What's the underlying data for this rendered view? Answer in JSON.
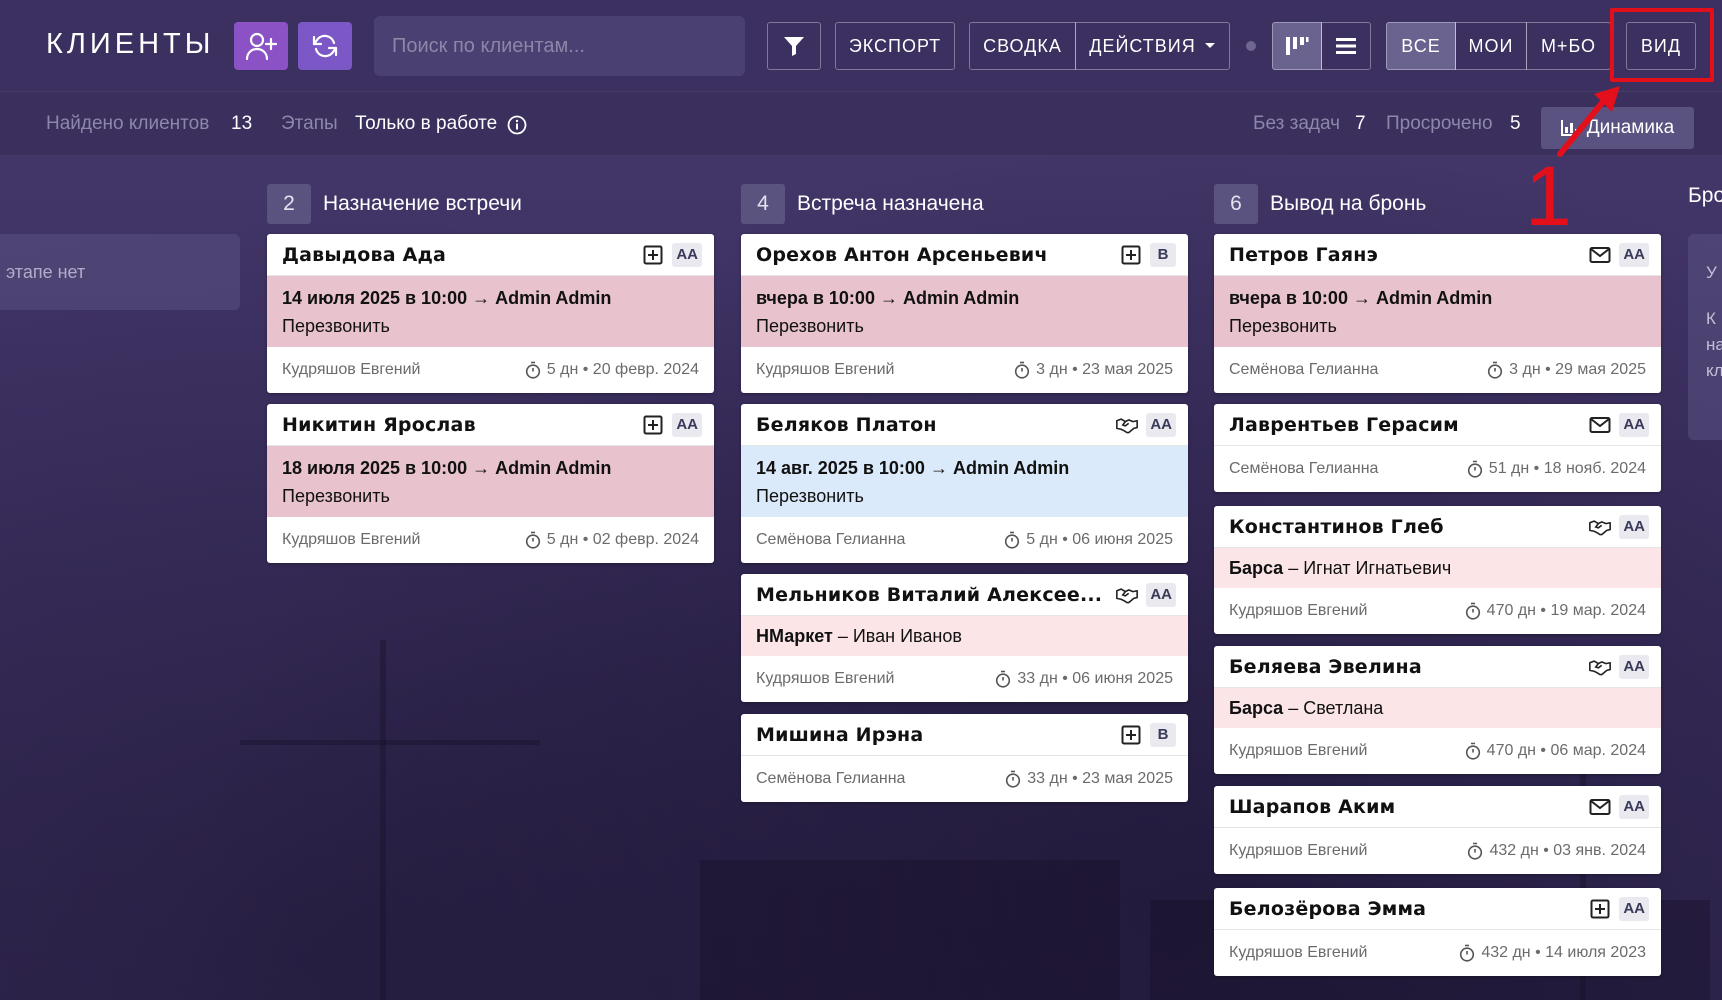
{
  "header": {
    "title": "КЛИЕНТЫ",
    "search_placeholder": "Поиск по клиентам...",
    "export_label": "ЭКСПОРТ",
    "summary_label": "СВОДКА",
    "actions_label": "ДЕЙСТВИЯ",
    "filter_all": "ВСЕ",
    "filter_mine": "МОИ",
    "filter_mplus": "М+БО",
    "view_label": "ВИД"
  },
  "subbar": {
    "found_label": "Найдено клиентов",
    "found_count": "13",
    "stages_label": "Этапы",
    "stages_value": "Только в работе",
    "no_tasks_label": "Без задач",
    "no_tasks_count": "7",
    "overdue_label": "Просрочено",
    "overdue_count": "5",
    "dynamics_label": "Динамика"
  },
  "annotation": {
    "step_number": "1"
  },
  "columns": {
    "left_empty_text": "этапе нет",
    "partial_next": {
      "title": "Бро",
      "lines": [
        "У",
        "К",
        "на",
        "кл"
      ]
    },
    "col1": {
      "count": "2",
      "title": "Назначение встречи",
      "cards": [
        {
          "name": "Давыдова Ада",
          "icon": "plus-square-icon",
          "badge": "АА",
          "task_line": "14 июля 2025 в 10:00 → Admin Admin",
          "task_note": "Перезвонить",
          "manager": "Кудряшов Евгений",
          "meta": "5 дн • 20 февр. 2024"
        },
        {
          "name": "Никитин Ярослав",
          "icon": "plus-square-icon",
          "badge": "АА",
          "task_line": "18 июля 2025 в 10:00 → Admin Admin",
          "task_note": "Перезвонить",
          "manager": "Кудряшов Евгений",
          "meta": "5 дн • 02 февр. 2024"
        }
      ]
    },
    "col2": {
      "count": "4",
      "title": "Встреча назначена",
      "cards": [
        {
          "name": "Орехов Антон Арсеньевич",
          "icon": "plus-square-icon",
          "badge": "В",
          "task_line": "вчера в 10:00 → Admin Admin",
          "task_note": "Перезвонить",
          "manager": "Кудряшов Евгений",
          "meta": "3 дн • 23 мая 2025"
        },
        {
          "name": "Беляков Платон",
          "icon": "handshake-icon",
          "badge": "АА",
          "task_line": "14 авг. 2025 в 10:00 → Admin Admin",
          "task_note": "Перезвонить",
          "manager": "Семёнова Гелианна",
          "meta": "5 дн • 06 июня 2025"
        },
        {
          "name": "Мельников Виталий Алексее...",
          "icon": "handshake-icon",
          "badge": "АА",
          "partner_bold": "НМаркет",
          "partner_rest": " – Иван Иванов",
          "manager": "Кудряшов Евгений",
          "meta": "33 дн • 06 июня 2025"
        },
        {
          "name": "Мишина Ирэна",
          "icon": "plus-square-icon",
          "badge": "В",
          "manager": "Семёнова Гелианна",
          "meta": "33 дн • 23 мая 2025"
        }
      ]
    },
    "col3": {
      "count": "6",
      "title": "Вывод на бронь",
      "cards": [
        {
          "name": "Петров Гаянэ",
          "icon": "mail-icon",
          "badge": "АА",
          "task_line": "вчера в 10:00 → Admin Admin",
          "task_note": "Перезвонить",
          "manager": "Семёнова Гелианна",
          "meta": "3 дн • 29 мая 2025"
        },
        {
          "name": "Лаврентьев Герасим",
          "icon": "mail-icon",
          "badge": "АА",
          "manager": "Семёнова Гелианна",
          "meta": "51 дн • 18 нояб. 2024"
        },
        {
          "name": "Константинов Глеб",
          "icon": "handshake-icon",
          "badge": "АА",
          "partner_bold": "Барса",
          "partner_rest": " – Игнат Игнатьевич",
          "manager": "Кудряшов Евгений",
          "meta": "470 дн • 19 мар. 2024"
        },
        {
          "name": "Беляева Эвелина",
          "icon": "handshake-icon",
          "badge": "АА",
          "partner_bold": "Барса",
          "partner_rest": " – Светлана",
          "manager": "Кудряшов Евгений",
          "meta": "470 дн • 06 мар. 2024"
        },
        {
          "name": "Шарапов Аким",
          "icon": "mail-icon",
          "badge": "АА",
          "manager": "Кудряшов Евгений",
          "meta": "432 дн • 03 янв. 2024"
        },
        {
          "name": "Белозёрова Эмма",
          "icon": "plus-square-icon",
          "badge": "АА",
          "manager": "Кудряшов Евгений",
          "meta": "432 дн • 14 июля 2023"
        }
      ]
    }
  },
  "colors": {
    "accent_purple": "#8a52c4",
    "task_overdue": "#e8c2cd",
    "task_planned": "#dbeafa",
    "partner_bg": "#fbe5e7",
    "annotation_red": "#e3101c"
  }
}
